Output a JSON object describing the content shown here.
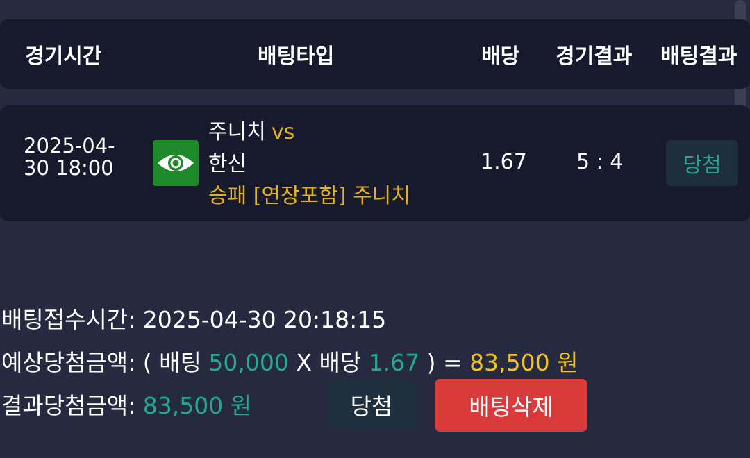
{
  "header": {
    "col_time": "경기시간",
    "col_bet_type": "배팅타입",
    "col_odds": "배당",
    "col_game_result": "경기결과",
    "col_bet_result": "배팅결과"
  },
  "bet_row": {
    "time_line1": "2025-04-",
    "time_line2": "30 18:00",
    "icon": "eye-icon",
    "home_team": "주니치",
    "vs": "vs",
    "away_team": "한신",
    "pick": "승패 [연장포함] 주니치",
    "odds": "1.67",
    "score": "5 : 4",
    "result": "당첨"
  },
  "info": {
    "receipt_label": "배팅접수시간:",
    "receipt_time": "2025-04-30 20:18:15",
    "expected_label": "예상당첨금액:",
    "open_paren": "( 배팅",
    "stake": "50,000",
    "times_odds": "X 배당",
    "odds": "1.67",
    "close_eq": ") =",
    "expected_amount": "83,500 원",
    "result_label": "결과당첨금액:",
    "result_amount": "83,500 원"
  },
  "actions": {
    "win_label": "당첨",
    "delete_label": "배팅삭제"
  },
  "colors": {
    "background": "#262a40",
    "card": "#171a2c",
    "accent_green": "#24a88f",
    "accent_yellow": "#f2c21e",
    "danger": "#d93a3a"
  }
}
